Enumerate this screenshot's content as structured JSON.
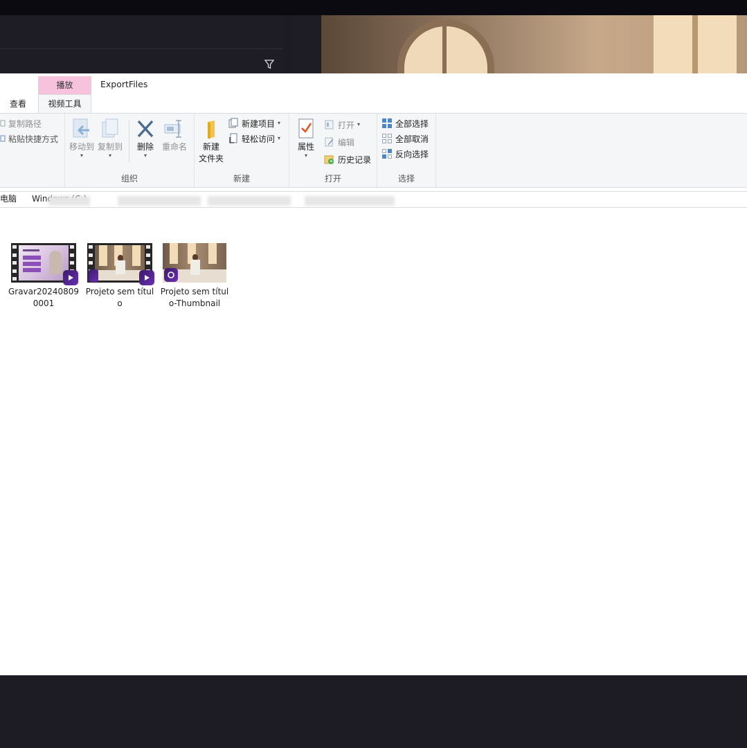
{
  "background_app": {
    "filter_icon": "filter-icon"
  },
  "explorer": {
    "tabs": {
      "view_label": "查看",
      "context_header": "播放",
      "context_tab": "视频工具",
      "window_title": "ExportFiles"
    },
    "ribbon": {
      "clipboard": {
        "copy_path": "复制路径",
        "paste_shortcut": "粘贴快捷方式"
      },
      "organize": {
        "label": "组织",
        "move_to": "移动到",
        "copy_to": "复制到",
        "delete": "删除",
        "rename": "重命名"
      },
      "new": {
        "label": "新建",
        "new_folder_line1": "新建",
        "new_folder_line2": "文件夹",
        "new_item": "新建项目",
        "easy_access": "轻松访问"
      },
      "open": {
        "label": "打开",
        "properties": "属性",
        "open": "打开",
        "edit": "编辑",
        "history": "历史记录"
      },
      "select": {
        "label": "选择",
        "select_all": "全部选择",
        "select_none": "全部取消",
        "invert_selection": "反向选择"
      }
    },
    "address": {
      "seg_pc": "电脑",
      "seg_drive": "Windows (C:)"
    },
    "files": [
      {
        "name": "Gravar2024080​90001",
        "type": "video"
      },
      {
        "name": "Projeto sem tí​tulo",
        "type": "video"
      },
      {
        "name": "Projeto sem tí​tulo-Thumbnail",
        "type": "video-thumbnail"
      }
    ]
  },
  "colors": {
    "context_tab": "#f7c3dc",
    "ribbon_bg": "#f5f6f7",
    "dark_bg": "#1d1c25",
    "badge": "#5a27a0"
  }
}
